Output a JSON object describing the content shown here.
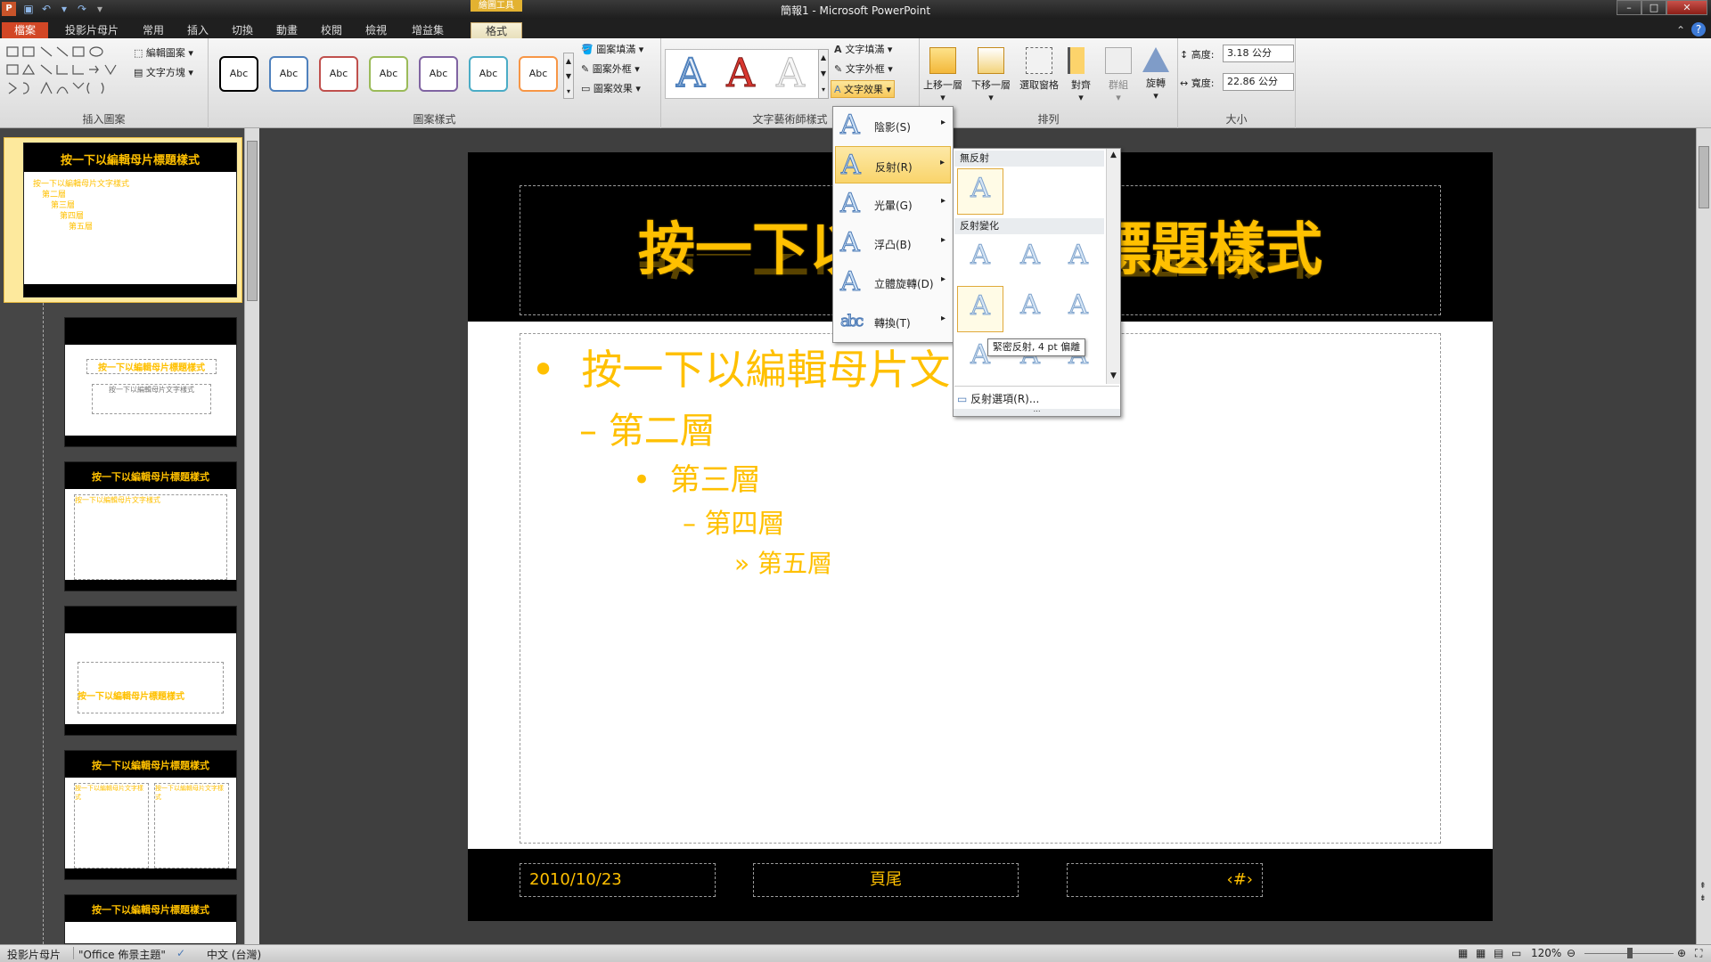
{
  "window": {
    "title": "簡報1 - Microsoft PowerPoint",
    "tool_header": "繪圖工具",
    "minimize": "–",
    "maximize": "□",
    "close": "✕"
  },
  "qat": {
    "save_icon": "save-icon",
    "undo_icon": "undo-icon",
    "redo_icon": "redo-icon"
  },
  "tabs": [
    "檔案",
    "投影片母片",
    "常用",
    "插入",
    "切換",
    "動畫",
    "校閱",
    "檢視",
    "增益集",
    "格式"
  ],
  "ribbon": {
    "insert_shapes": {
      "label": "插入圖案",
      "edit_shape": "編輯圖案",
      "text_box": "文字方塊"
    },
    "shape_styles": {
      "label": "圖案樣式",
      "sample": "Abc",
      "fill": "圖案填滿",
      "outline": "圖案外框",
      "effects": "圖案效果",
      "colors": [
        "#000000",
        "#4f81bd",
        "#c0504d",
        "#9bbb59",
        "#8064a2",
        "#4bacc6",
        "#f79646"
      ]
    },
    "wordart": {
      "label": "文字藝術師樣式",
      "glyph": "A",
      "text_fill": "文字填滿",
      "text_outline": "文字外框",
      "text_effects": "文字效果"
    },
    "arrange": {
      "label": "排列",
      "bring_forward": "上移一層",
      "send_backward": "下移一層",
      "selection_pane": "選取窗格",
      "align": "對齊",
      "group": "群組",
      "rotate": "旋轉"
    },
    "size": {
      "label": "大小",
      "height_label": "高度:",
      "height_value": "3.18 公分",
      "width_label": "寬度:",
      "width_value": "22.86 公分"
    }
  },
  "effects_menu": {
    "glyph": "A",
    "items": [
      "陰影(S)",
      "反射(R)",
      "光暈(G)",
      "浮凸(B)",
      "立體旋轉(D)",
      "轉換(T)"
    ]
  },
  "reflection_panel": {
    "no_reflection": "無反射",
    "variations": "反射變化",
    "glyph": "A",
    "options": "反射選項(R)...",
    "tooltip": "緊密反射, 4 pt 偏離"
  },
  "thumbnails": {
    "number": "1",
    "title": "按一下以編輯母片標題樣式",
    "body": "按一下以編輯母片文字樣式",
    "level2": "第二層",
    "level3": "第三層",
    "level4": "第四層",
    "level5": "第五層"
  },
  "slide": {
    "title": "按一下以編輯母片標題樣式",
    "levels": [
      "按一下以編輯母片文字樣式",
      "第二層",
      "第三層",
      "第四層",
      "第五層"
    ],
    "bullets": [
      "•",
      "–",
      "•",
      "–",
      "»"
    ],
    "date": "2010/10/23",
    "footer": "頁尾",
    "page_num": "‹#›"
  },
  "status": {
    "view": "投影片母片",
    "theme": "\"Office 佈景主題\"",
    "language": "中文 (台灣)",
    "zoom": "120%"
  }
}
